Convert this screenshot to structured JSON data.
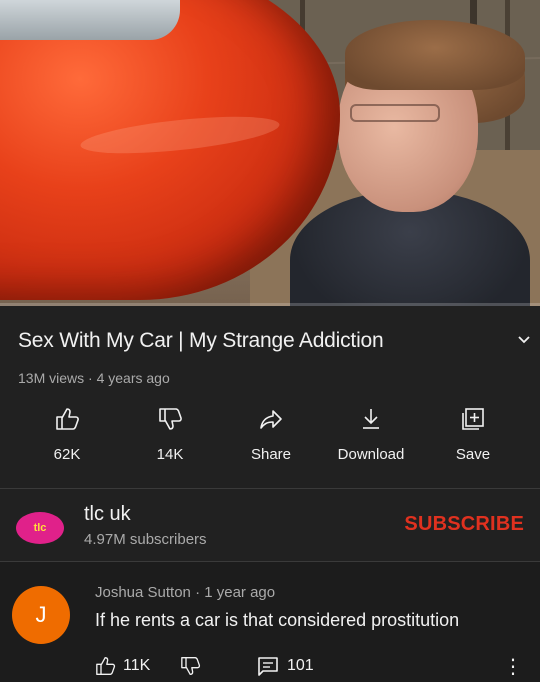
{
  "video": {
    "progress_fraction": 0.0
  },
  "details": {
    "title": "Sex With My Car | My Strange Addiction",
    "meta": "13M views · 4 years ago"
  },
  "actions": [
    {
      "label": "62K",
      "icon": "thumbs-up-icon"
    },
    {
      "label": "14K",
      "icon": "thumbs-down-icon"
    },
    {
      "label": "Share",
      "icon": "share-icon"
    },
    {
      "label": "Download",
      "icon": "download-icon"
    },
    {
      "label": "Save",
      "icon": "save-playlist-icon"
    }
  ],
  "channel": {
    "name": "tlc uk",
    "subscribers": "4.97M subscribers",
    "subscribe_label": "SUBSCRIBE",
    "avatar_text": "tlc",
    "avatar_color": "#e0218a"
  },
  "comment": {
    "author_initial": "J",
    "meta": "Joshua Sutton · 1 year ago",
    "text": "If he rents a car is that considered prostitution",
    "likes": "11K",
    "replies": "101",
    "avatar_color": "#ef6c00"
  },
  "colors": {
    "background": "#212121",
    "subscribe": "#e0311f"
  }
}
